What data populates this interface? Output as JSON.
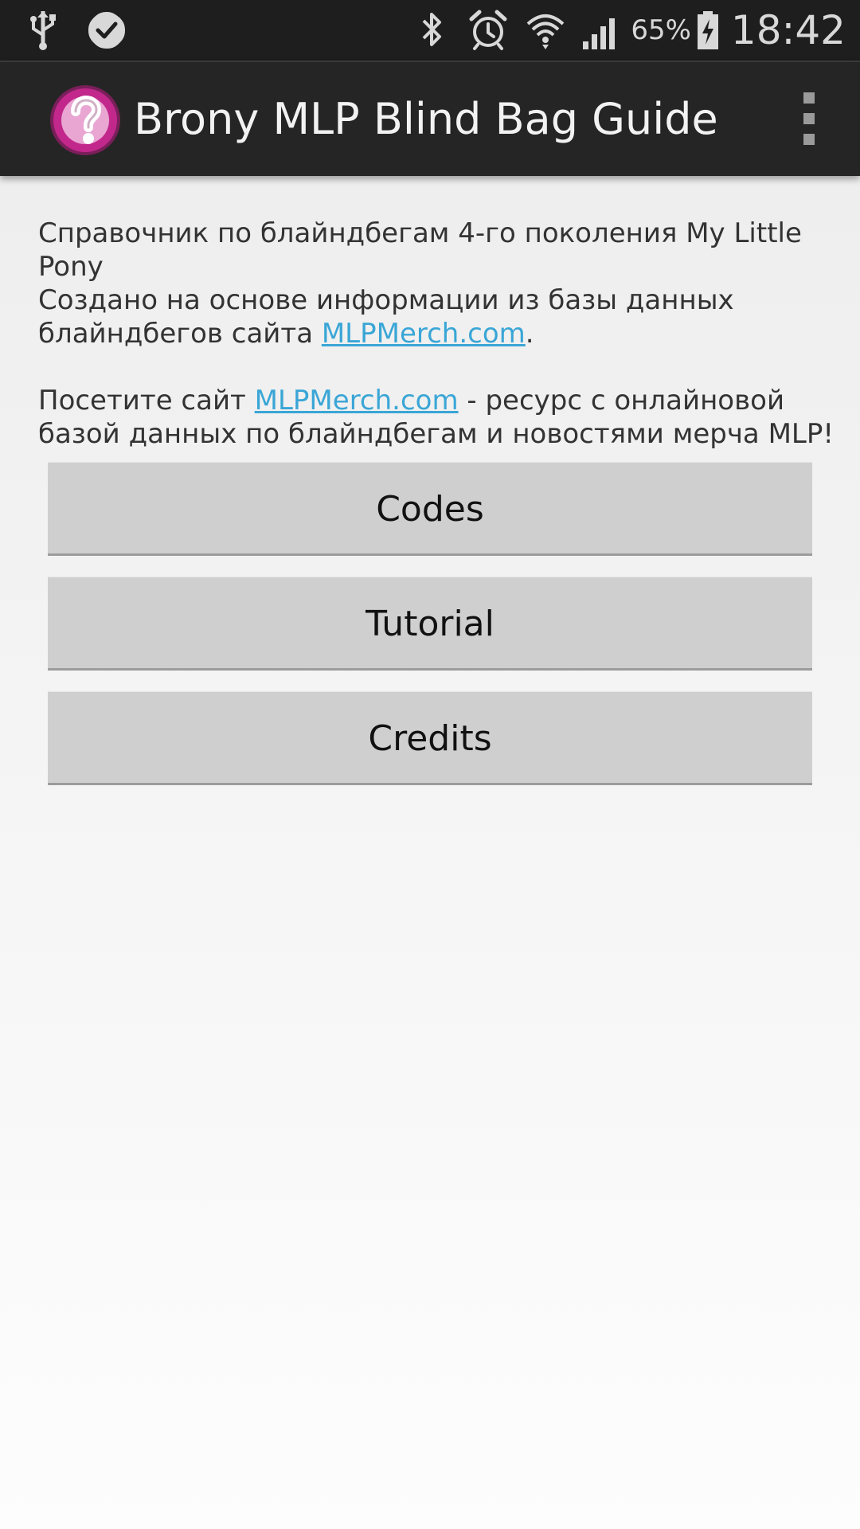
{
  "status_bar": {
    "left_icons": [
      "usb-icon",
      "checkmark-notification-icon"
    ],
    "right_icons": [
      "bluetooth-icon",
      "alarm-icon",
      "wifi-icon",
      "signal-icon",
      "battery-charging-icon"
    ],
    "battery_percent": "65%",
    "time": "18:42"
  },
  "action_bar": {
    "icon": "question-mark-icon",
    "title": "Brony MLP Blind Bag Guide",
    "overflow_icon": "overflow-menu-icon"
  },
  "intro": {
    "line1": "Справочник по блайндбегам 4-го поколения My Little Pony",
    "line2_prefix": "Создано на основе информации из базы данных блайндбегов сайта ",
    "line2_link": "MLPMerch.com",
    "line2_suffix": ".",
    "line3_prefix": "Посетите сайт ",
    "line3_link": "MLPMerch.com",
    "line3_suffix": " - ресурс с онлайновой базой данных по блайндбегам и новостями мерча MLP!"
  },
  "buttons": {
    "codes": "Codes",
    "tutorial": "Tutorial",
    "credits": "Credits"
  },
  "colors": {
    "status_bar_bg": "#1e1e1e",
    "action_bar_bg": "#252525",
    "link": "#3aa6d6",
    "button_bg": "#cfcfcf",
    "app_icon_magenta": "#c2288c"
  }
}
